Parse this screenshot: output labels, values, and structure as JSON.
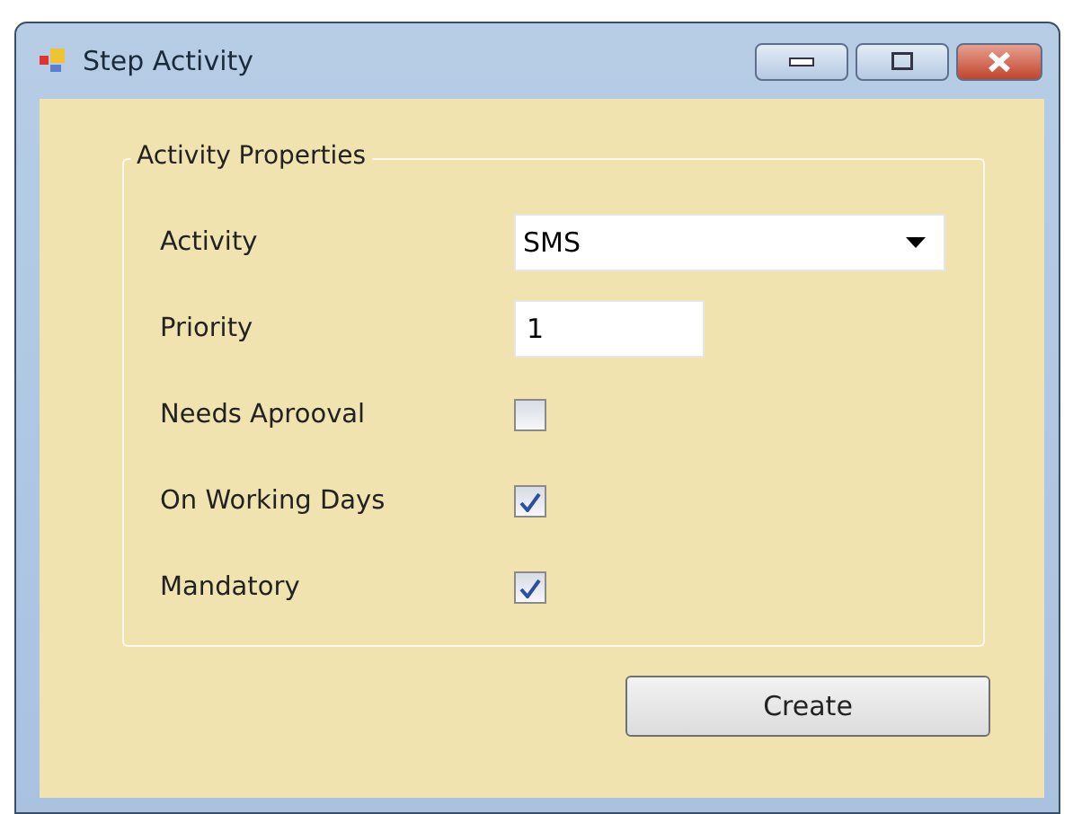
{
  "window": {
    "title": "Step Activity"
  },
  "group": {
    "title": "Activity Properties"
  },
  "fields": [
    {
      "kind": "dropdown",
      "label": "Activity",
      "value": "SMS"
    },
    {
      "kind": "text",
      "label": "Priority",
      "value": "1"
    },
    {
      "kind": "checkbox",
      "label": "Needs Aprooval",
      "checked": false
    },
    {
      "kind": "checkbox",
      "label": "On Working Days",
      "checked": true
    },
    {
      "kind": "checkbox",
      "label": "Mandatory",
      "checked": true
    }
  ],
  "buttons": [
    "Create"
  ]
}
